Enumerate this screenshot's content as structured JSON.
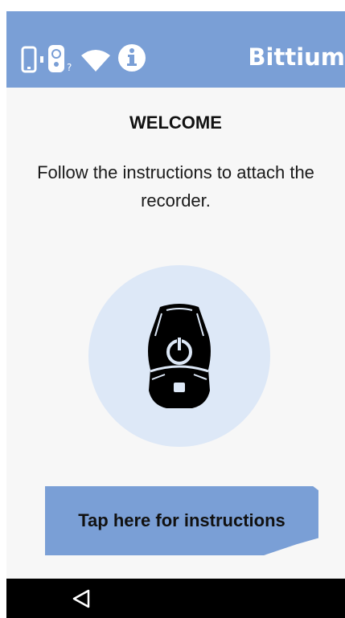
{
  "header": {
    "brand": "Bittium",
    "status_icons": [
      "phone-icon",
      "sensor-icon",
      "wifi-icon",
      "info-icon"
    ]
  },
  "main": {
    "title": "WELCOME",
    "instruction": "Follow the instructions to attach the recorder.",
    "illustration": "recorder-device-icon",
    "cta_label": "Tap here for instructions"
  },
  "navbar": {
    "back_icon": "back-triangle-icon"
  },
  "colors": {
    "accent": "#7a9fd6",
    "circle": "#dde8f7",
    "background": "#f7f7f7",
    "navbar": "#000000"
  }
}
